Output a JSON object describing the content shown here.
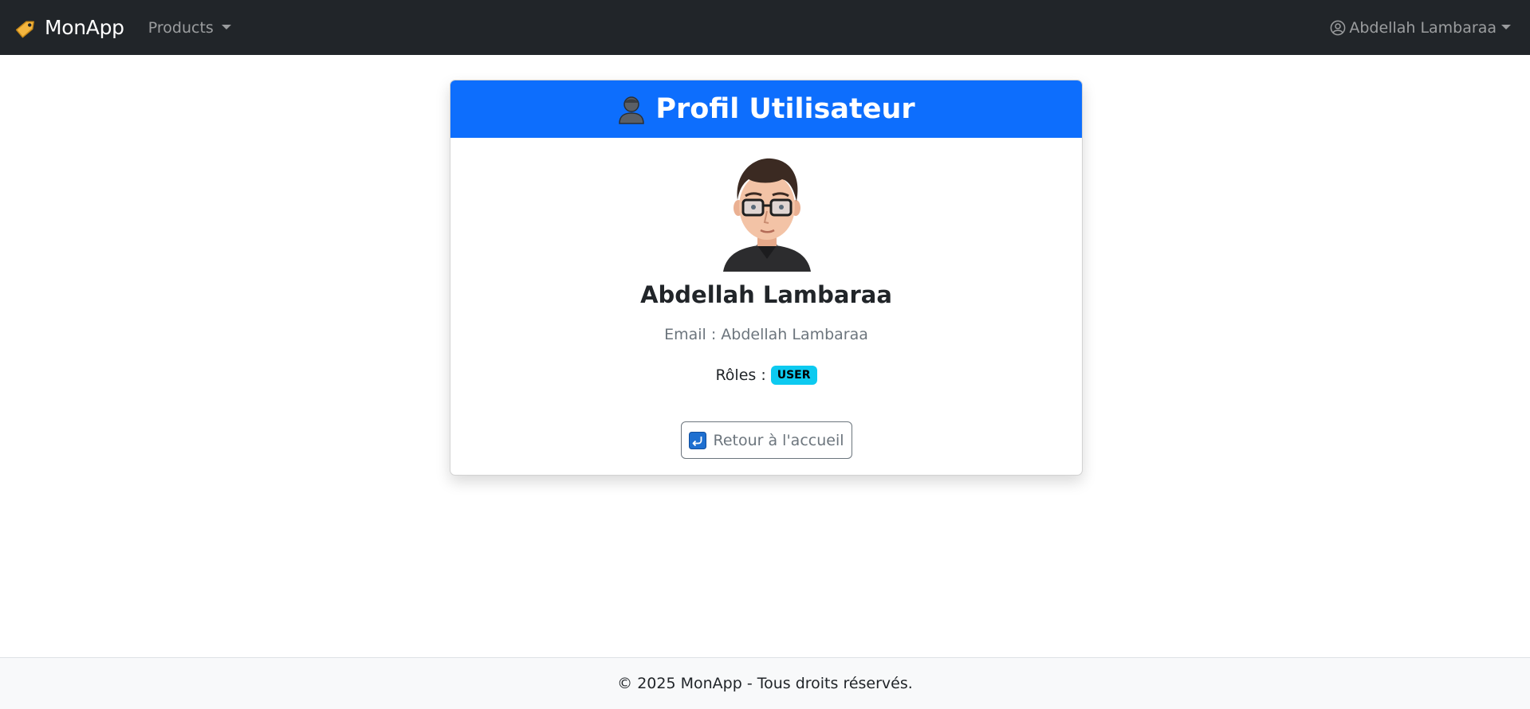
{
  "navbar": {
    "brand": {
      "icon": "price-tag-icon",
      "label": "MonApp"
    },
    "products_menu": {
      "label": "Products",
      "icon": "chevron-down-icon"
    },
    "user_menu": {
      "icon": "person-circle-icon",
      "label": "Abdellah Lambaraa",
      "caret": "chevron-down-icon"
    }
  },
  "profile_card": {
    "header": {
      "icon": "bust-in-silhouette-icon",
      "title": "Profil Utilisateur",
      "background": "#0d6efd"
    },
    "avatar": {
      "icon": "man-with-glasses-avatar"
    },
    "name": "Abdellah Lambaraa",
    "email_line": "Email : Abdellah Lambaraa",
    "roles": {
      "label": "Rôles :",
      "items": [
        "USER"
      ],
      "badge_color": "#0dcaf0"
    },
    "back_button": {
      "icon": "return-arrow-icon",
      "label": "Retour à l'accueil"
    }
  },
  "footer": {
    "text": "© 2025 MonApp - Tous droits réservés."
  }
}
